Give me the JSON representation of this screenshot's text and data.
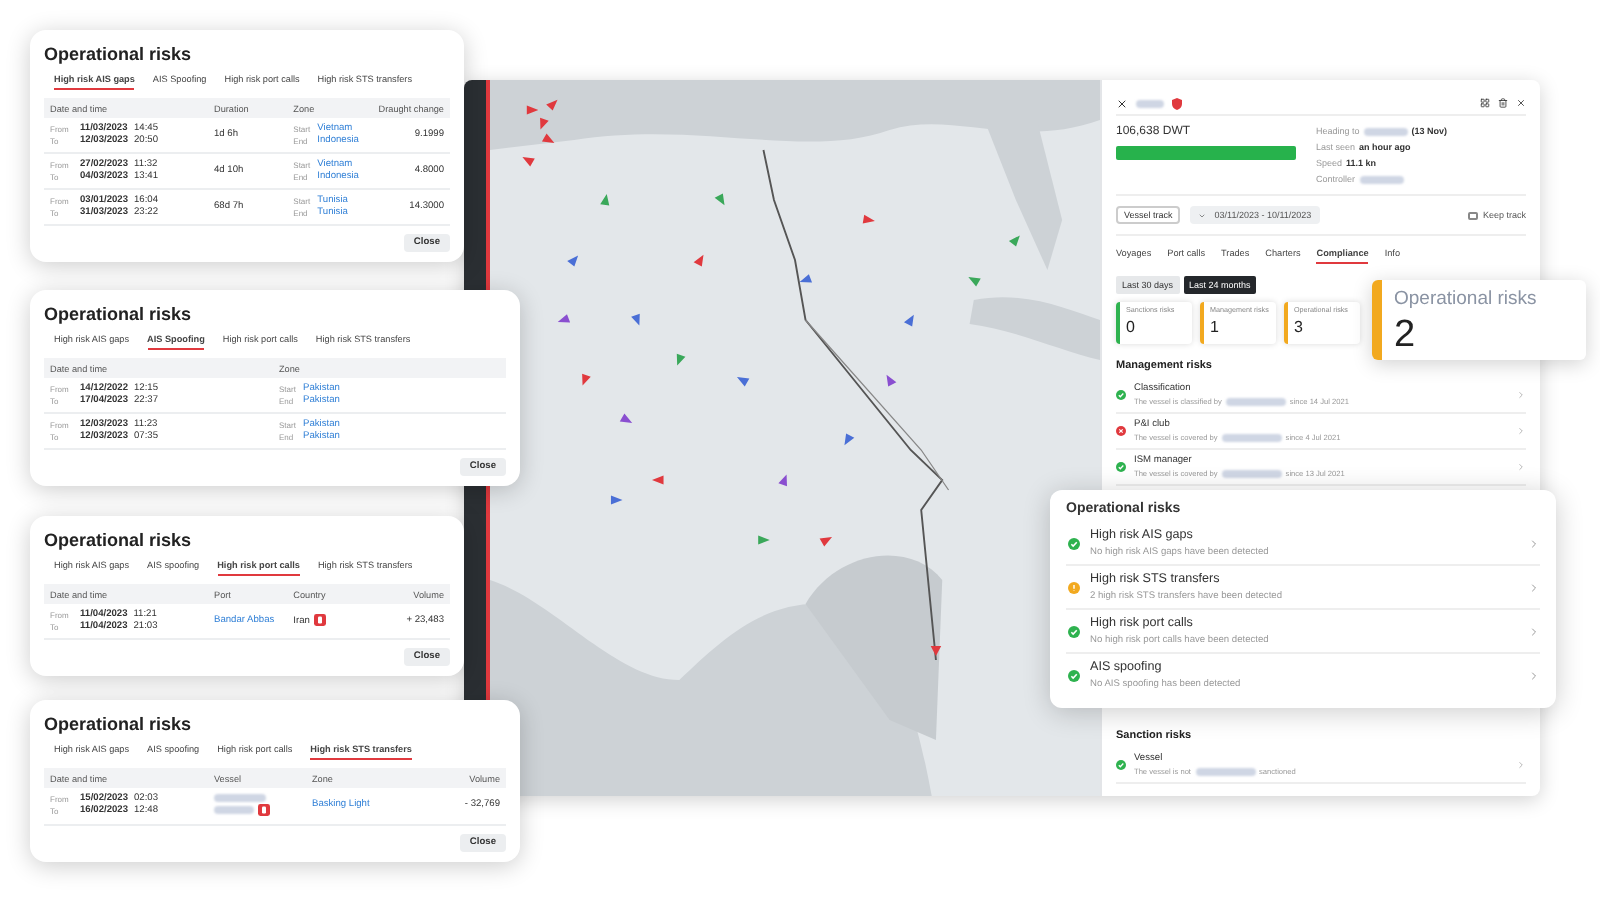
{
  "risk_dialogs": [
    {
      "title": "Operational risks",
      "tabs": [
        {
          "label": "High risk AIS gaps",
          "selected": true
        },
        {
          "label": "AIS Spoofing",
          "selected": false
        },
        {
          "label": "High risk port calls",
          "selected": false
        },
        {
          "label": "High risk STS transfers",
          "selected": false
        }
      ],
      "columns": [
        "Date and time",
        "Duration",
        "Zone",
        "Draught change"
      ],
      "rows": [
        {
          "cells": [
            {
              "kind": "range",
              "from": {
                "label": "From",
                "date": "11/03/2023",
                "time": "14:45"
              },
              "to": {
                "label": "To",
                "date": "12/03/2023",
                "time": "20:50"
              }
            },
            {
              "kind": "text",
              "text": "1d 6h"
            },
            {
              "kind": "zone",
              "start_label": "Start",
              "start": "Vietnam",
              "end_label": "End",
              "end": "Indonesia"
            },
            {
              "kind": "number",
              "text": "9.1999"
            }
          ]
        },
        {
          "cells": [
            {
              "kind": "range",
              "from": {
                "label": "From",
                "date": "27/02/2023",
                "time": "11:32"
              },
              "to": {
                "label": "To",
                "date": "04/03/2023",
                "time": "13:41"
              }
            },
            {
              "kind": "text",
              "text": "4d 10h"
            },
            {
              "kind": "zone",
              "start_label": "Start",
              "start": "Vietnam",
              "end_label": "End",
              "end": "Indonesia"
            },
            {
              "kind": "number",
              "text": "4.8000"
            }
          ]
        },
        {
          "cells": [
            {
              "kind": "range",
              "from": {
                "label": "From",
                "date": "03/01/2023",
                "time": "16:04"
              },
              "to": {
                "label": "To",
                "date": "31/03/2023",
                "time": "23:22"
              }
            },
            {
              "kind": "text",
              "text": "68d 7h"
            },
            {
              "kind": "zone",
              "start_label": "Start",
              "start": "Tunisia",
              "end_label": "End",
              "end": "Tunisia"
            },
            {
              "kind": "number",
              "text": "14.3000"
            }
          ]
        }
      ],
      "close": "Close"
    },
    {
      "title": "Operational risks",
      "tabs": [
        {
          "label": "High risk AIS gaps",
          "selected": false
        },
        {
          "label": "AIS Spoofing",
          "selected": true
        },
        {
          "label": "High risk port calls",
          "selected": false
        },
        {
          "label": "High risk STS transfers",
          "selected": false
        }
      ],
      "columns": [
        "Date and time",
        "Zone"
      ],
      "rows": [
        {
          "cells": [
            {
              "kind": "range",
              "from": {
                "label": "From",
                "date": "14/12/2022",
                "time": "12:15"
              },
              "to": {
                "label": "To",
                "date": "17/04/2023",
                "time": "22:37"
              }
            },
            {
              "kind": "zone",
              "start_label": "Start",
              "start": "Pakistan",
              "end_label": "End",
              "end": "Pakistan"
            }
          ]
        },
        {
          "cells": [
            {
              "kind": "range",
              "from": {
                "label": "From",
                "date": "12/03/2023",
                "time": "11:23"
              },
              "to": {
                "label": "To",
                "date": "12/03/2023",
                "time": "07:35"
              }
            },
            {
              "kind": "zone",
              "start_label": "Start",
              "start": "Pakistan",
              "end_label": "End",
              "end": "Pakistan"
            }
          ]
        }
      ],
      "close": "Close"
    },
    {
      "title": "Operational risks",
      "tabs": [
        {
          "label": "High risk AIS gaps",
          "selected": false
        },
        {
          "label": "AIS spoofing",
          "selected": false
        },
        {
          "label": "High risk port calls",
          "selected": true
        },
        {
          "label": "High risk STS transfers",
          "selected": false
        }
      ],
      "columns": [
        "Date and time",
        "Port",
        "Country",
        "Volume"
      ],
      "rows": [
        {
          "cells": [
            {
              "kind": "range",
              "from": {
                "label": "From",
                "date": "11/04/2023",
                "time": "11:21"
              },
              "to": {
                "label": "To",
                "date": "11/04/2023",
                "time": "21:03"
              }
            },
            {
              "kind": "link",
              "text": "Bandar Abbas"
            },
            {
              "kind": "country",
              "text": "Iran",
              "flagged": true
            },
            {
              "kind": "number",
              "text": "+ 23,483"
            }
          ]
        }
      ],
      "close": "Close"
    },
    {
      "title": "Operational risks",
      "tabs": [
        {
          "label": "High risk AIS gaps",
          "selected": false
        },
        {
          "label": "AIS spoofing",
          "selected": false
        },
        {
          "label": "High risk port calls",
          "selected": false
        },
        {
          "label": "High risk STS transfers",
          "selected": true
        }
      ],
      "columns": [
        "Date and time",
        "Vessel",
        "Zone",
        "Volume"
      ],
      "rows": [
        {
          "cells": [
            {
              "kind": "range",
              "from": {
                "label": "From",
                "date": "15/02/2023",
                "time": "02:03"
              },
              "to": {
                "label": "To",
                "date": "16/02/2023",
                "time": "12:48"
              }
            },
            {
              "kind": "vessel",
              "flagged": true
            },
            {
              "kind": "link",
              "text": "Basking Light"
            },
            {
              "kind": "number",
              "text": "- 32,769"
            }
          ]
        }
      ],
      "close": "Close"
    }
  ],
  "vessel_panel": {
    "dwt": "106,638 DWT",
    "facts": [
      {
        "label": "Heading to",
        "value": "(13 Nov)",
        "redacted": true
      },
      {
        "label": "Last seen",
        "value": "an hour ago",
        "redacted": false
      },
      {
        "label": "Speed",
        "value": "11.1 kn",
        "redacted": false
      },
      {
        "label": "Controller",
        "redacted": true
      }
    ],
    "track": {
      "label": "Vessel track",
      "range": "03/11/2023 - 10/11/2023",
      "keep_label": "Keep track",
      "keep_checked": false
    },
    "tabs": [
      {
        "label": "Voyages",
        "selected": false
      },
      {
        "label": "Port calls",
        "selected": false
      },
      {
        "label": "Trades",
        "selected": false
      },
      {
        "label": "Charters",
        "selected": false
      },
      {
        "label": "Compliance",
        "selected": true
      },
      {
        "label": "Info",
        "selected": false
      }
    ],
    "periods": [
      {
        "label": "Last 30 days",
        "selected": false
      },
      {
        "label": "Last 24 months",
        "selected": true
      }
    ],
    "risk_counts": [
      {
        "label": "Sanctions risks",
        "count": "0",
        "color": "#2eb24f"
      },
      {
        "label": "Management risks",
        "count": "1",
        "color": "#f2a91f"
      },
      {
        "label": "Operational risks",
        "count": "3",
        "color": "#f2a91f"
      }
    ],
    "highlight": {
      "label": "Operational risks",
      "count": "2",
      "color": "#f2a91f"
    },
    "management": {
      "title": "Management risks",
      "items": [
        {
          "title": "Classification",
          "kind": "ok",
          "before": "The vessel is classified by",
          "after": "since 14 Jul 2021"
        },
        {
          "title": "P&I club",
          "kind": "error",
          "before": "The vessel is covered by",
          "after": "since 4 Jul 2021"
        },
        {
          "title": "ISM manager",
          "kind": "ok",
          "before": "The vessel is covered by",
          "after": "since 13 Jul 2021"
        }
      ]
    },
    "sanctions": {
      "title": "Sanction risks",
      "items": [
        {
          "title": "Vessel",
          "kind": "ok",
          "before": "The vessel is not",
          "after": "sanctioned"
        }
      ]
    }
  },
  "operational_summary": {
    "title": "Operational risks",
    "items": [
      {
        "title": "High risk AIS gaps",
        "detail": "No high risk AIS gaps have been detected",
        "kind": "ok"
      },
      {
        "title": "High risk STS transfers",
        "detail": "2 high risk STS transfers have been detected",
        "kind": "warning"
      },
      {
        "title": "High risk port calls",
        "detail": "No high risk port calls have been detected",
        "kind": "ok"
      },
      {
        "title": "AIS spoofing",
        "detail": "No AIS spoofing has been detected",
        "kind": "ok"
      }
    ]
  }
}
